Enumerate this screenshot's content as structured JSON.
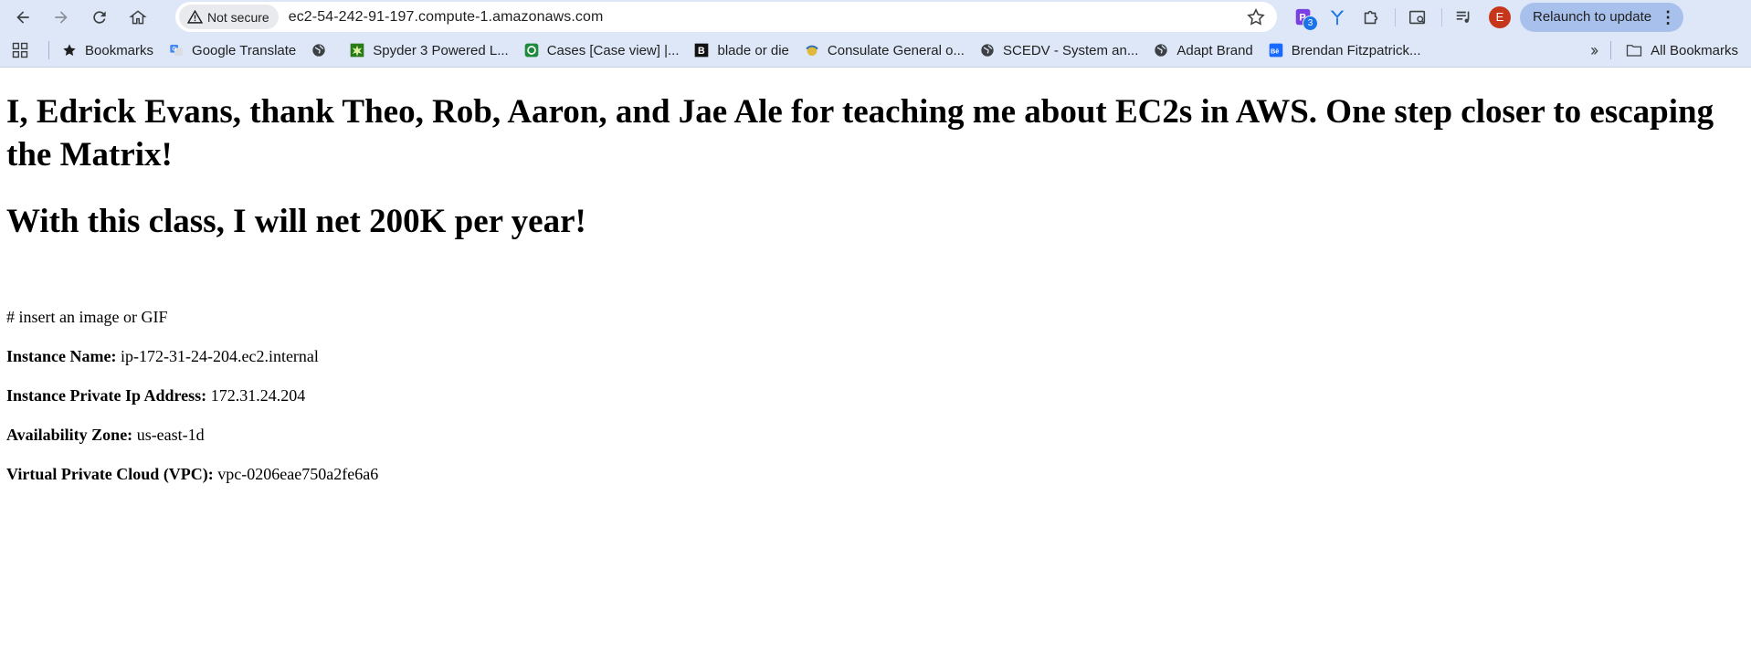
{
  "browser": {
    "security_label": "Not secure",
    "url": "ec2-54-242-91-197.compute-1.amazonaws.com",
    "extension_badge": "3",
    "profile_initial": "E",
    "relaunch_label": "Relaunch to update"
  },
  "bookmarks": {
    "items": [
      {
        "label": "Bookmarks",
        "icon": "star-icon"
      },
      {
        "label": "Google Translate",
        "icon": "google-translate-icon"
      },
      {
        "label": "",
        "icon": "globe-icon"
      },
      {
        "label": "Spyder 3 Powered L...",
        "icon": "spyder-icon"
      },
      {
        "label": "Cases [Case view] |...",
        "icon": "cases-icon"
      },
      {
        "label": "blade or die",
        "icon": "b-icon"
      },
      {
        "label": "Consulate General o...",
        "icon": "consulate-icon"
      },
      {
        "label": "SCEDV - System an...",
        "icon": "globe-icon"
      },
      {
        "label": "Adapt Brand",
        "icon": "globe-icon"
      },
      {
        "label": "Brendan Fitzpatrick...",
        "icon": "behance-icon"
      }
    ],
    "all_bookmarks": "All Bookmarks"
  },
  "page": {
    "heading1": "I, Edrick Evans, thank Theo, Rob, Aaron, and Jae Ale for teaching me about EC2s in AWS. One step closer to escaping the Matrix!",
    "heading2": "With this class, I will net 200K per year!",
    "comment": "# insert an image or GIF",
    "fields": [
      {
        "label": "Instance Name:",
        "value": " ip-172-31-24-204.ec2.internal"
      },
      {
        "label": "Instance Private Ip Address:",
        "value": " 172.31.24.204"
      },
      {
        "label": "Availability Zone:",
        "value": " us-east-1d"
      },
      {
        "label": "Virtual Private Cloud (VPC):",
        "value": " vpc-0206eae750a2fe6a6"
      }
    ]
  }
}
